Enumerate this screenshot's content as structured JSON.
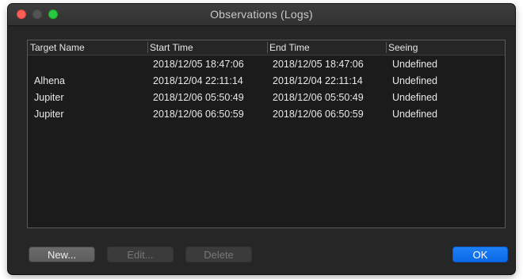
{
  "window": {
    "title": "Observations (Logs)"
  },
  "table": {
    "columns": [
      "Target Name",
      "Start Time",
      "End Time",
      "Seeing"
    ],
    "rows": [
      {
        "target": "",
        "start": "2018/12/05 18:47:06",
        "end": "2018/12/05 18:47:06",
        "seeing": "Undefined"
      },
      {
        "target": "Alhena",
        "start": "2018/12/04 22:11:14",
        "end": "2018/12/04 22:11:14",
        "seeing": "Undefined"
      },
      {
        "target": "Jupiter",
        "start": "2018/12/06 05:50:49",
        "end": "2018/12/06 05:50:49",
        "seeing": "Undefined"
      },
      {
        "target": "Jupiter",
        "start": "2018/12/06 06:50:59",
        "end": "2018/12/06 06:50:59",
        "seeing": "Undefined"
      }
    ]
  },
  "buttons": {
    "new": "New...",
    "edit": "Edit...",
    "delete": "Delete",
    "ok": "OK"
  },
  "colors": {
    "window_background": "#262626",
    "table_background": "#1b1b1b",
    "accent": "#0a6ae8",
    "close": "#ff5f57",
    "zoom": "#28c840"
  }
}
